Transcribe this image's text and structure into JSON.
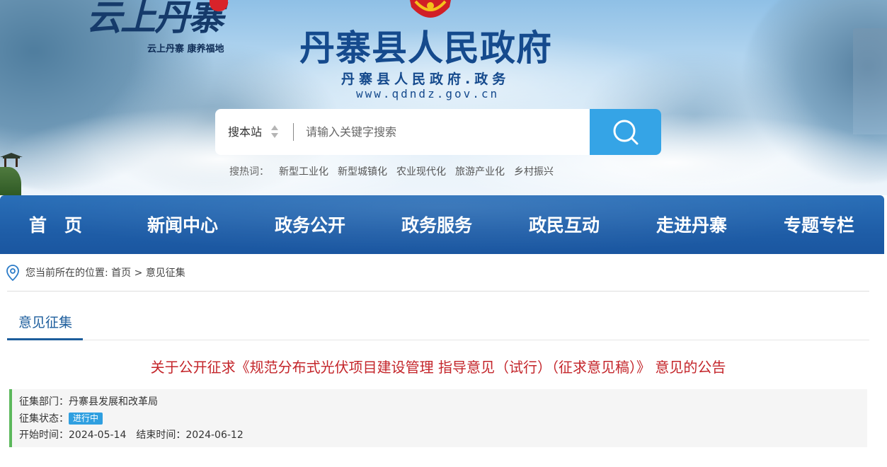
{
  "banner": {
    "logo_title": "云上丹寨",
    "logo_badge_text": "",
    "logo_slogan": "云上丹寨  康养福地",
    "gov_title": "丹寨县人民政府",
    "gov_subtitle": "丹寨县人民政府.政务",
    "gov_url": "www.qdndz.gov.cn"
  },
  "search": {
    "scope_label": "搜本站",
    "placeholder": "请输入关键字搜索",
    "button_icon": "search-icon"
  },
  "hot_words": {
    "label": "搜热词：",
    "items": [
      "新型工业化",
      "新型城镇化",
      "农业现代化",
      "旅游产业化",
      "乡村振兴"
    ]
  },
  "nav": {
    "items": [
      "首　页",
      "新闻中心",
      "政务公开",
      "政务服务",
      "政民互动",
      "走进丹寨",
      "专题专栏"
    ]
  },
  "breadcrumb": {
    "prefix": "您当前所在的位置: ",
    "home": "首页",
    "separator": " > ",
    "current": "意见征集"
  },
  "section": {
    "tab_label": "意见征集"
  },
  "article": {
    "title": "关于公开征求《规范分布式光伏项目建设管理 指导意见（试行）（征求意见稿）》 意见的公告",
    "department_label": "征集部门：",
    "department": "丹寨县发展和改革局",
    "status_label": "征集状态：",
    "status": "进行中",
    "start_label": "开始时间：",
    "start_date": "2024-05-14",
    "end_label": "结束时间：",
    "end_date": "2024-06-12"
  },
  "colors": {
    "nav_blue": "#1f5ea8",
    "title_red": "#c4262b",
    "search_button": "#35a4e6",
    "status_badge": "#2f9fe0",
    "info_accent": "#5cb85c",
    "tab_blue": "#1c5d9c"
  }
}
